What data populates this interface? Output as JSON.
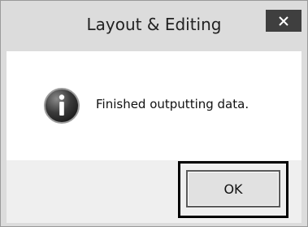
{
  "dialog": {
    "title": "Layout & Editing",
    "close_icon": "close-x-icon",
    "message_icon": "info-icon",
    "message": "Finished outputting data.",
    "ok_label": "OK"
  },
  "colors": {
    "window_frame": "#dcdcdc",
    "close_button": "#3f3f3f",
    "content_bg": "#ffffff",
    "footer_bg": "#efefef",
    "highlight_border": "#000000"
  }
}
